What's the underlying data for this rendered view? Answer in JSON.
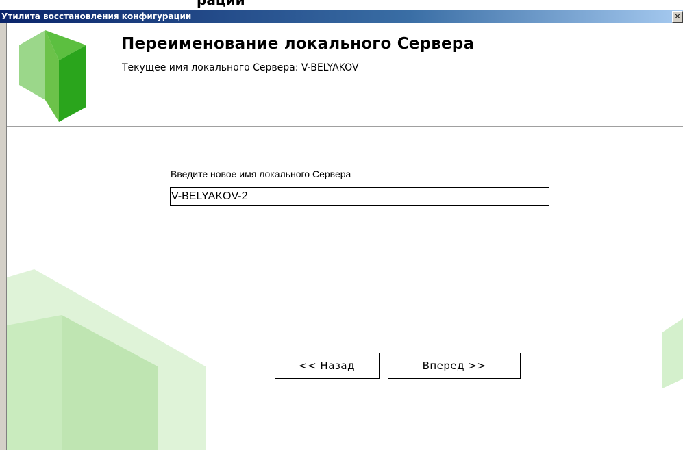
{
  "window": {
    "title": "Утилита восстановления конфигурации",
    "close_label": "×",
    "cut_text_above": "рации"
  },
  "header": {
    "title": "Переименование локального Сервера",
    "subtitle": "Текущее имя локального Сервера: V-BELYAKOV"
  },
  "form": {
    "label": "Введите новое имя локального Сервера",
    "value": "V-BELYAKOV-2"
  },
  "buttons": {
    "back_label": "<< Назад",
    "next_label": "Вперед >>"
  },
  "colors": {
    "logo_dark": "#2ca02c",
    "logo_mid": "#6cc24a",
    "logo_light": "#a8dc98",
    "decor_light": "#d4f0cc"
  }
}
